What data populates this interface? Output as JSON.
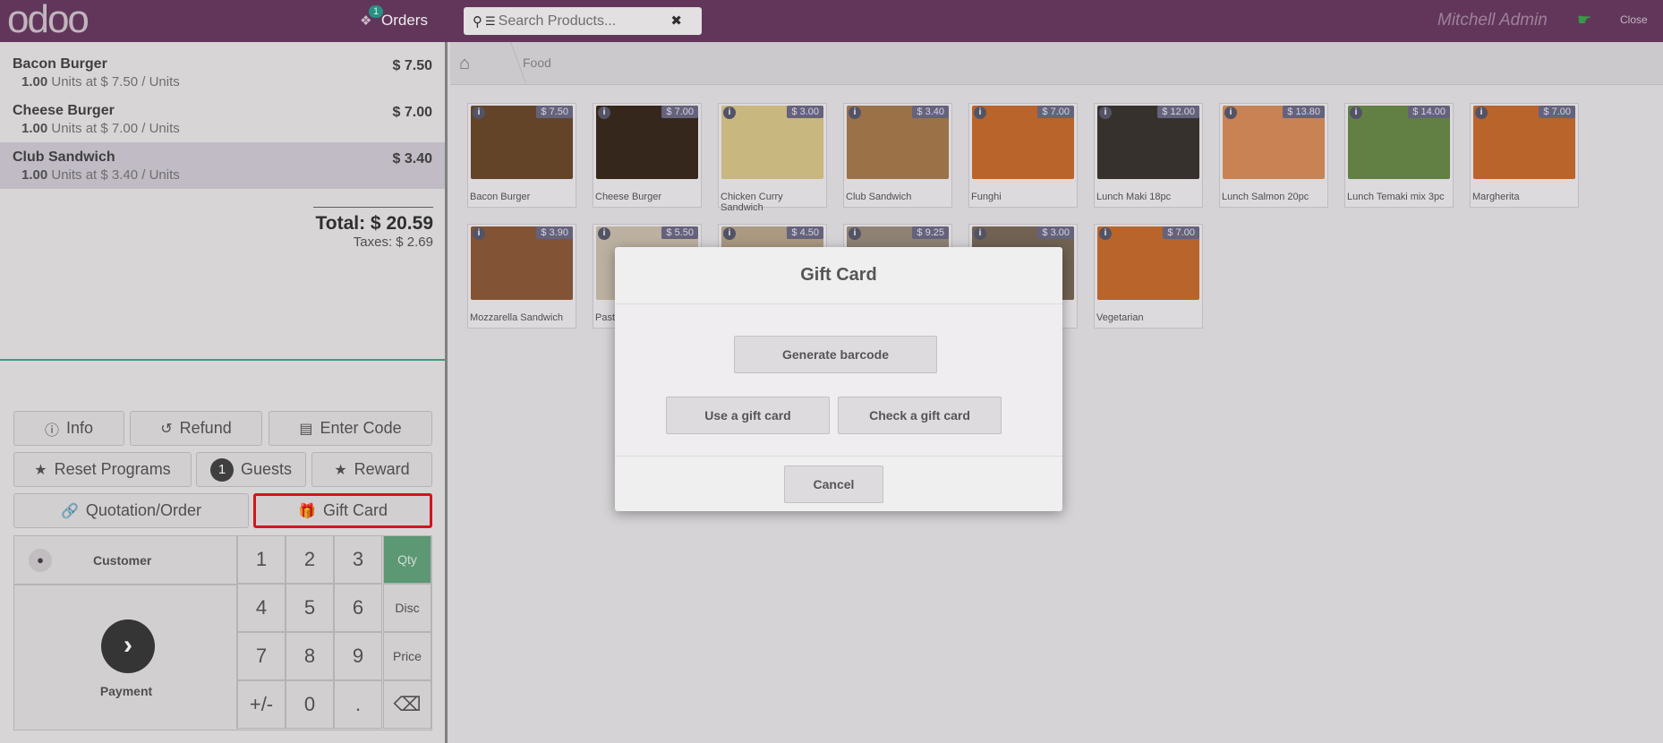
{
  "topbar": {
    "logo": "odoo",
    "orders_label": "Orders",
    "orders_badge": "1",
    "search_placeholder": "Search Products...",
    "user": "Mitchell Admin",
    "close_label": "Close"
  },
  "order": {
    "lines": [
      {
        "name": "Bacon Burger",
        "price": "$ 7.50",
        "qty": "1.00",
        "detail": " Units at $ 7.50 / Units"
      },
      {
        "name": "Cheese Burger",
        "price": "$ 7.00",
        "qty": "1.00",
        "detail": " Units at $ 7.00 / Units"
      },
      {
        "name": "Club Sandwich",
        "price": "$ 3.40",
        "qty": "1.00",
        "detail": " Units at $ 3.40 / Units"
      }
    ],
    "total": "Total: $ 20.59",
    "taxes": "Taxes: $ 2.69"
  },
  "controls": {
    "info": "Info",
    "refund": "Refund",
    "enter_code": "Enter Code",
    "reset_programs": "Reset Programs",
    "guests_count": "1",
    "guests": "Guests",
    "reward": "Reward",
    "quotation": "Quotation/Order",
    "gift_card": "Gift Card"
  },
  "numpad": {
    "customer": "Customer",
    "payment": "Payment",
    "keys": [
      "1",
      "2",
      "3",
      "4",
      "5",
      "6",
      "7",
      "8",
      "9",
      "+/-",
      "0",
      "."
    ],
    "modes": [
      "Qty",
      "Disc",
      "Price"
    ]
  },
  "breadcrumb": {
    "category": "Food"
  },
  "products": [
    {
      "name": "Bacon Burger",
      "price": "$ 7.50",
      "color": "#6b4a2c"
    },
    {
      "name": "Cheese Burger",
      "price": "$ 7.00",
      "color": "#3a2a1e"
    },
    {
      "name": "Chicken Curry Sandwich",
      "price": "$ 3.00",
      "color": "#d9c58a"
    },
    {
      "name": "Club Sandwich",
      "price": "$ 3.40",
      "color": "#a77a4e"
    },
    {
      "name": "Funghi",
      "price": "$ 7.00",
      "color": "#c86c2e"
    },
    {
      "name": "Lunch Maki 18pc",
      "price": "$ 12.00",
      "color": "#3b3530"
    },
    {
      "name": "Lunch Salmon 20pc",
      "price": "$ 13.80",
      "color": "#d88c5a"
    },
    {
      "name": "Lunch Temaki mix 3pc",
      "price": "$ 14.00",
      "color": "#6b8a4a"
    },
    {
      "name": "Margherita",
      "price": "$ 7.00",
      "color": "#c86c2e"
    },
    {
      "name": "Mozzarella Sandwich",
      "price": "$ 3.90",
      "color": "#8c5a3a"
    },
    {
      "name": "Pasta",
      "price": "$ 5.50",
      "color": "#cbbfae"
    },
    {
      "name": "",
      "price": "$ 4.50",
      "color": "#b9a58c"
    },
    {
      "name": "",
      "price": "$ 9.25",
      "color": "#9a8c7e"
    },
    {
      "name": "",
      "price": "$ 3.00",
      "color": "#7a6a5a"
    },
    {
      "name": "Vegetarian",
      "price": "$ 7.00",
      "color": "#c86c2e"
    }
  ],
  "modal": {
    "title": "Gift Card",
    "generate": "Generate barcode",
    "use": "Use a gift card",
    "check": "Check a gift card",
    "cancel": "Cancel"
  }
}
